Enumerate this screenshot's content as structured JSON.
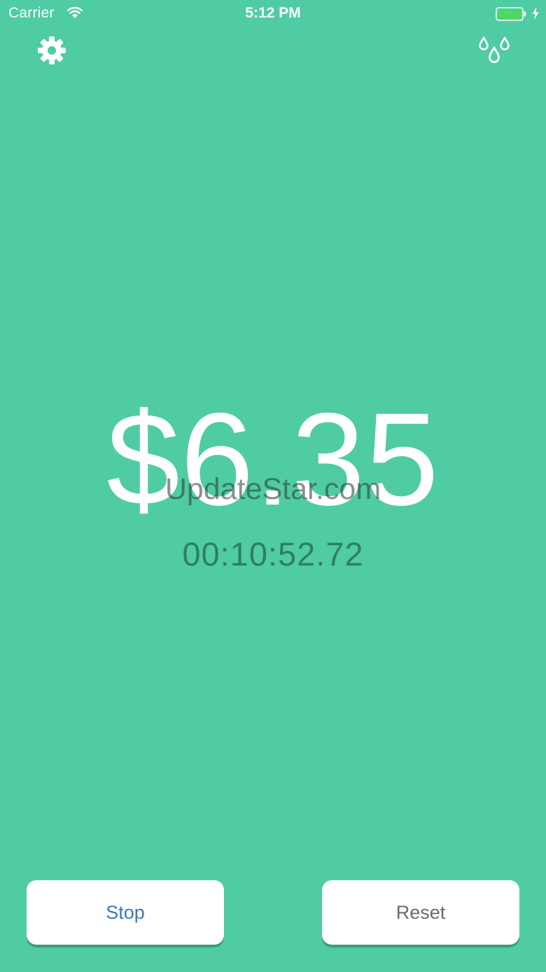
{
  "status_bar": {
    "carrier": "Carrier",
    "time": "5:12 PM",
    "wifi_icon": "wifi-icon",
    "battery_icon": "battery-icon",
    "charging_icon": "charging-bolt-icon",
    "battery_level": 1.0
  },
  "toolbar": {
    "settings_icon": "gear-icon",
    "theme_icon": "droplets-icon"
  },
  "meter": {
    "amount": "$6.35",
    "elapsed": "00:10:52.72"
  },
  "watermark": "UpdateStar.com",
  "actions": {
    "stop_label": "Stop",
    "reset_label": "Reset"
  },
  "colors": {
    "background": "#50cca4",
    "amount_text": "#ffffff",
    "timer_text": "#2f7e66",
    "stop_text": "#3a78b8",
    "reset_text": "#6b6b6b",
    "battery_fill": "#4cd964"
  }
}
